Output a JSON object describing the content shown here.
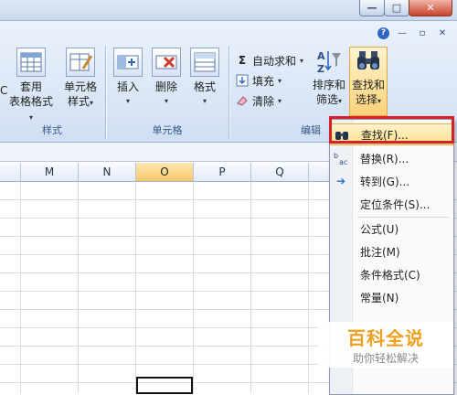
{
  "window": {
    "buttons": [
      "—",
      "□",
      "✕"
    ]
  },
  "ribbon_right": {
    "help": "?",
    "minimize": "—",
    "restore": "▫",
    "close": "✕"
  },
  "groups": {
    "styles": {
      "label": "样式",
      "cut_label_top": "C",
      "table_format": {
        "line1": "套用",
        "line2": "表格格式"
      },
      "cell_style": {
        "line1": "单元格",
        "line2": "样式"
      }
    },
    "cells": {
      "label": "单元格",
      "insert": "插入",
      "delete": "删除",
      "format": "格式"
    },
    "editing": {
      "label": "编辑",
      "autosum": "自动求和",
      "fill": "填充",
      "clear": "清除",
      "sort": {
        "line1": "排序和",
        "line2": "筛选"
      },
      "find": {
        "line1": "查找和",
        "line2": "选择"
      }
    }
  },
  "columns": [
    "M",
    "N",
    "O",
    "P",
    "Q"
  ],
  "selected_column": "O",
  "menu": {
    "items": [
      {
        "icon": "binoculars-icon",
        "label": "查找(F)..."
      },
      {
        "icon": "replace-icon",
        "label": "替换(R)..."
      },
      {
        "icon": "arrow-right-icon",
        "label": "转到(G)..."
      },
      {
        "icon": "",
        "label": "定位条件(S)..."
      },
      {
        "icon": "",
        "label": "公式(U)"
      },
      {
        "icon": "",
        "label": "批注(M)"
      },
      {
        "icon": "",
        "label": "条件格式(C)"
      },
      {
        "icon": "",
        "label": "常量(N)"
      }
    ]
  },
  "watermark": {
    "title": "百科全说",
    "subtitle": "助你轻松解决"
  }
}
